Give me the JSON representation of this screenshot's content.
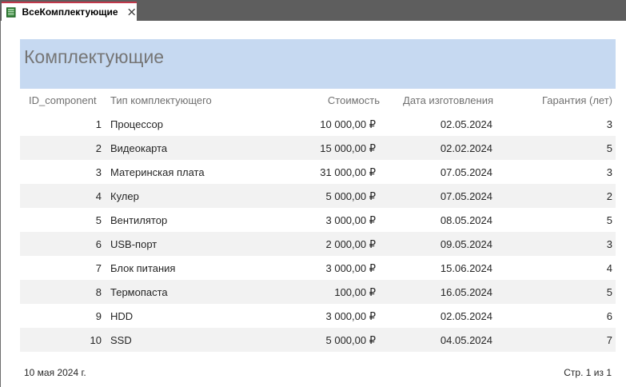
{
  "tab": {
    "label": "ВсеКомплектующие",
    "icon": "report-icon",
    "close_icon": "close-icon"
  },
  "report": {
    "title": "Комплектующие",
    "header_color": "#c6d9f1",
    "columns": {
      "id": "ID_component",
      "type": "Тип комплектующего",
      "cost": "Стоимость",
      "date": "Дата изготовления",
      "warranty": "Гарантия (лет)"
    },
    "rows": [
      {
        "id": "1",
        "type": "Процессор",
        "cost": "10 000,00 ₽",
        "date": "02.05.2024",
        "warranty": "3"
      },
      {
        "id": "2",
        "type": "Видеокарта",
        "cost": "15 000,00 ₽",
        "date": "02.02.2024",
        "warranty": "5"
      },
      {
        "id": "3",
        "type": "Материнская плата",
        "cost": "31 000,00 ₽",
        "date": "07.05.2024",
        "warranty": "3"
      },
      {
        "id": "4",
        "type": "Кулер",
        "cost": "5 000,00 ₽",
        "date": "07.05.2024",
        "warranty": "2"
      },
      {
        "id": "5",
        "type": "Вентилятор",
        "cost": "3 000,00 ₽",
        "date": "08.05.2024",
        "warranty": "5"
      },
      {
        "id": "6",
        "type": "USB-порт",
        "cost": "2 000,00 ₽",
        "date": "09.05.2024",
        "warranty": "3"
      },
      {
        "id": "7",
        "type": "Блок питания",
        "cost": "3 000,00 ₽",
        "date": "15.06.2024",
        "warranty": "4"
      },
      {
        "id": "8",
        "type": "Термопаста",
        "cost": "100,00 ₽",
        "date": "16.05.2024",
        "warranty": "5"
      },
      {
        "id": "9",
        "type": "HDD",
        "cost": "3 000,00 ₽",
        "date": "02.05.2024",
        "warranty": "6"
      },
      {
        "id": "10",
        "type": "SSD",
        "cost": "5 000,00 ₽",
        "date": "04.05.2024",
        "warranty": "7"
      }
    ]
  },
  "footer": {
    "date": "10 мая 2024 г.",
    "page": "Стр. 1 из 1"
  }
}
